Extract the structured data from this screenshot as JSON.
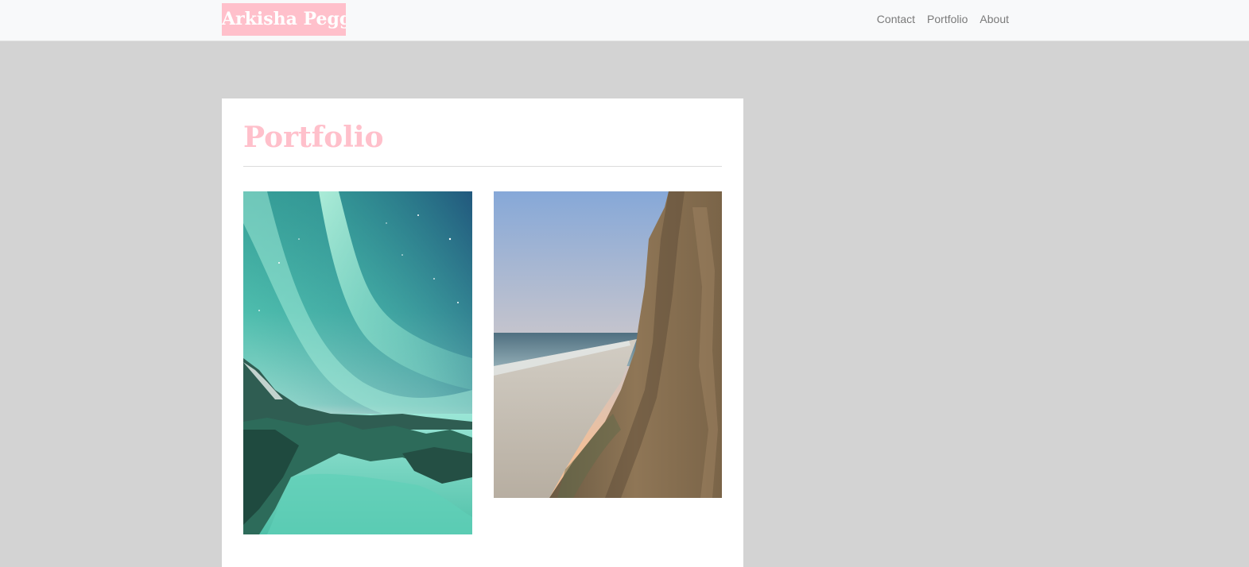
{
  "header": {
    "brand": "Arkisha Peggs",
    "nav": [
      {
        "label": "Contact"
      },
      {
        "label": "Portfolio"
      },
      {
        "label": "About"
      }
    ]
  },
  "main": {
    "title": "Portfolio",
    "photos": [
      {
        "name": "aurora-photo"
      },
      {
        "name": "beach-cliff-photo"
      }
    ]
  },
  "colors": {
    "accent": "#ffc0cb",
    "page_background": "#d3d3d3",
    "navbar_background": "#f8f9fa",
    "nav_link": "#7a7a7a"
  }
}
